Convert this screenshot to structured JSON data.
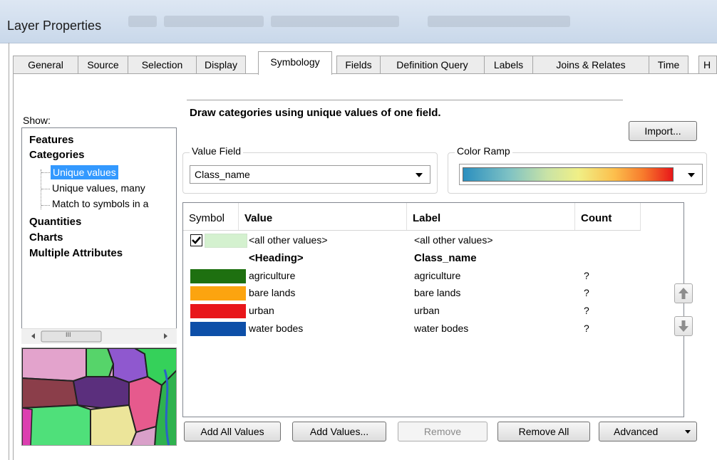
{
  "window": {
    "title": "Layer Properties"
  },
  "tabs": [
    {
      "label": "General"
    },
    {
      "label": "Source"
    },
    {
      "label": "Selection"
    },
    {
      "label": "Display"
    },
    {
      "label": "Symbology",
      "active": true
    },
    {
      "label": "Fields"
    },
    {
      "label": "Definition Query"
    },
    {
      "label": "Labels"
    },
    {
      "label": "Joins & Relates"
    },
    {
      "label": "Time"
    },
    {
      "label": "H"
    }
  ],
  "show": {
    "label": "Show:",
    "nodes": {
      "features": "Features",
      "categories": "Categories",
      "unique_values": "Unique values",
      "unique_values_many": "Unique values, many",
      "match_symbols": "Match to symbols in a",
      "quantities": "Quantities",
      "charts": "Charts",
      "multiple_attributes": "Multiple Attributes"
    },
    "selected": "Unique values"
  },
  "symbology": {
    "description": "Draw categories using unique values of one field.",
    "import_label": "Import...",
    "value_field": {
      "label": "Value Field",
      "value": "Class_name"
    },
    "color_ramp": {
      "label": "Color Ramp"
    }
  },
  "table": {
    "headers": {
      "symbol": "Symbol",
      "value": "Value",
      "label": "Label",
      "count": "Count"
    },
    "other": {
      "checked": true,
      "value": "<all other values>",
      "label": "<all other values>",
      "color": "#d4f1cf"
    },
    "heading": {
      "value": "<Heading>",
      "label": "Class_name"
    },
    "rows": [
      {
        "value": "agriculture",
        "label": "agriculture",
        "count": "?",
        "color": "#1e7010"
      },
      {
        "value": "bare lands",
        "label": "bare lands",
        "count": "?",
        "color": "#fca40f"
      },
      {
        "value": "urban",
        "label": "urban",
        "count": "?",
        "color": "#e8161a"
      },
      {
        "value": "water bodes",
        "label": "water bodes",
        "count": "?",
        "color": "#0d4fa8"
      }
    ]
  },
  "buttons": {
    "add_all": "Add All Values",
    "add_values": "Add Values...",
    "remove": "Remove",
    "remove_all": "Remove All",
    "advanced": "Advanced"
  },
  "scrollbar": {
    "grip": "III"
  }
}
